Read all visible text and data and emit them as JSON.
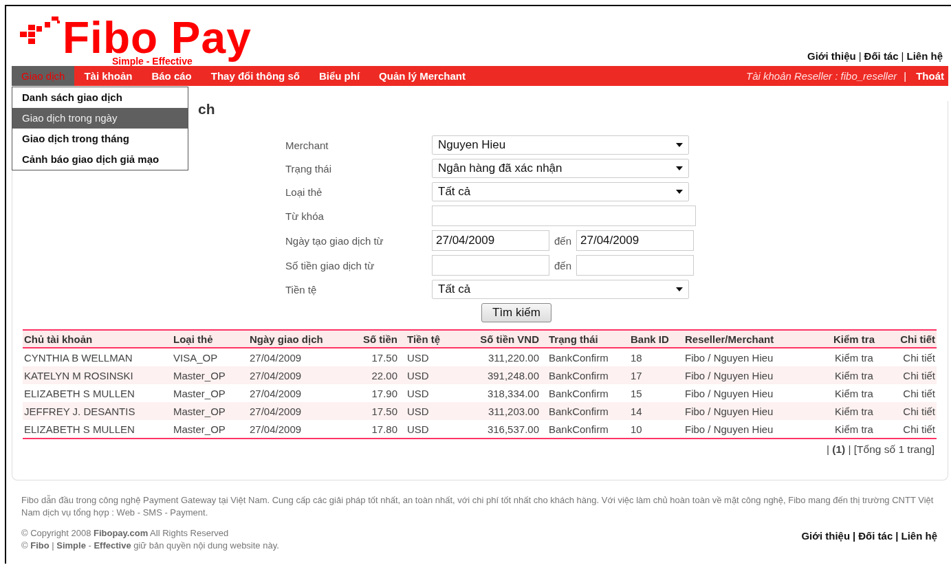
{
  "header": {
    "logo_name": "Fibo Pay",
    "logo_tagline": "Simple - Effective",
    "top_links": [
      "Giới thiệu",
      "Đối tác",
      "Liên hệ"
    ],
    "link_separator": "|"
  },
  "nav": {
    "items": [
      {
        "label": "Giao dịch",
        "selected": true
      },
      {
        "label": "Tài khoản",
        "selected": false
      },
      {
        "label": "Báo cáo",
        "selected": false
      },
      {
        "label": "Thay đổi thông số",
        "selected": false
      },
      {
        "label": "Biểu phí",
        "selected": false
      },
      {
        "label": "Quản lý Merchant",
        "selected": false
      }
    ],
    "account": "Tài khoản Reseller : fibo_reseller",
    "separator": "|",
    "logout": "Thoát",
    "dropdown": [
      {
        "label": "Danh sách giao dịch",
        "selected": false
      },
      {
        "label": "Giao dịch trong ngày",
        "selected": true
      },
      {
        "label": "Giao dịch trong tháng",
        "selected": false
      },
      {
        "label": "Cảnh báo giao dịch giả mạo",
        "selected": false
      }
    ]
  },
  "page_title": "ch",
  "form": {
    "fields": [
      {
        "kind": "select",
        "label": "Merchant",
        "value": "Nguyen Hieu"
      },
      {
        "kind": "select",
        "label": "Trạng thái",
        "value": "Ngân hàng đã xác nhận"
      },
      {
        "kind": "select",
        "label": "Loại thẻ",
        "value": "Tất cả"
      },
      {
        "kind": "text",
        "label": "Từ khóa"
      },
      {
        "kind": "range",
        "label": "Ngày tạo giao dịch từ",
        "from": "27/04/2009",
        "to_label": "đến",
        "to": "27/04/2009"
      },
      {
        "kind": "range",
        "label": "Số tiền giao dịch từ",
        "to_label": "đến"
      },
      {
        "kind": "select",
        "label": "Tiền tệ",
        "value": "Tất cả"
      }
    ],
    "search_button": "Tìm kiếm"
  },
  "table": {
    "columns": [
      "Chủ tài khoản",
      "Loại thẻ",
      "Ngày giao dịch",
      "Số tiền",
      "Tiền tệ",
      "Số tiền VND",
      "Trạng thái",
      "Bank ID",
      "Reseller/Merchant",
      "Kiểm tra",
      "Chi tiết"
    ],
    "rows": [
      [
        "CYNTHIA B WELLMAN",
        "VISA_OP",
        "27/04/2009",
        "17.50",
        "USD",
        "311,220.00",
        "BankConfirm",
        "18",
        "Fibo / Nguyen Hieu",
        "Kiểm tra",
        "Chi tiết"
      ],
      [
        "KATELYN M ROSINSKI",
        "Master_OP",
        "27/04/2009",
        "22.00",
        "USD",
        "391,248.00",
        "BankConfirm",
        "17",
        "Fibo / Nguyen Hieu",
        "Kiểm tra",
        "Chi tiết"
      ],
      [
        "ELIZABETH S MULLEN",
        "Master_OP",
        "27/04/2009",
        "17.90",
        "USD",
        "318,334.00",
        "BankConfirm",
        "15",
        "Fibo / Nguyen Hieu",
        "Kiểm tra",
        "Chi tiết"
      ],
      [
        "JEFFREY J. DESANTIS",
        "Master_OP",
        "27/04/2009",
        "17.50",
        "USD",
        "311,203.00",
        "BankConfirm",
        "14",
        "Fibo / Nguyen Hieu",
        "Kiểm tra",
        "Chi tiết"
      ],
      [
        "ELIZABETH S MULLEN",
        "Master_OP",
        "27/04/2009",
        "17.80",
        "USD",
        "316,537.00",
        "BankConfirm",
        "10",
        "Fibo / Nguyen Hieu",
        "Kiểm tra",
        "Chi tiết"
      ]
    ],
    "pagination": "| **(1)** |  [Tổng số 1 trang]"
  },
  "footer": {
    "about": "Fibo dẫn đầu trong công nghệ Payment Gateway tại Việt Nam. Cung cấp các giải pháp tốt nhất, an toàn nhất, với chi phí tốt nhất cho khách hàng. Với việc làm chủ hoàn toàn về mặt công nghệ, Fibo mang đến thị trường CNTT Việt Nam dịch vụ tổng hợp : Web - SMS - Payment.",
    "copyright": "© Copyright 2008 **Fibopay.com** All Rights Reserved",
    "ownership": "© **Fibo** | **Simple** - **Effective** giữ bản quyền nội dung website này.",
    "links": [
      "Giới thiệu",
      "Đối tác",
      "Liên hệ"
    ],
    "link_separator": "|"
  }
}
